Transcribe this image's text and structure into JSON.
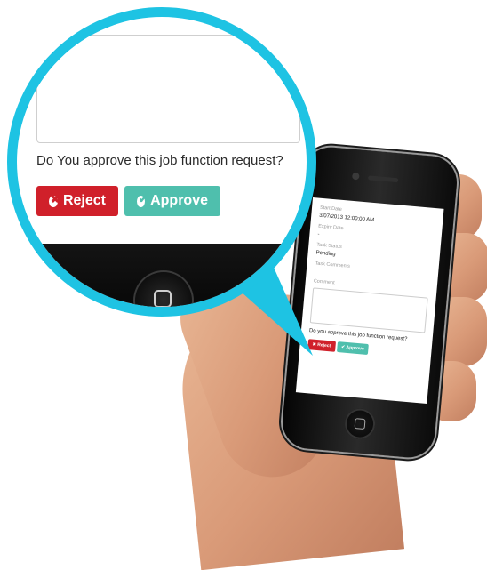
{
  "colors": {
    "magnifier_ring": "#1ec3e3",
    "reject": "#d0202a",
    "approve": "#4fbfad"
  },
  "magnified": {
    "question": "Do You approve this job function request?",
    "reject_label": "Reject",
    "approve_label": "Approve",
    "reject_icon": "times-circle-icon",
    "approve_icon": "check-circle-icon"
  },
  "screen": {
    "start_date_label": "Start Date",
    "start_date_value": "3/07/2013 12:00:00 AM",
    "expiry_date_label": "Expiry Date",
    "expiry_date_value": "-",
    "task_status_label": "Task Status",
    "task_status_value": "Pending",
    "task_comments_label": "Task Comments",
    "comment_label": "Comment",
    "question": "Do you approve this job function request?",
    "reject_label": "Reject",
    "approve_label": "Approve"
  }
}
